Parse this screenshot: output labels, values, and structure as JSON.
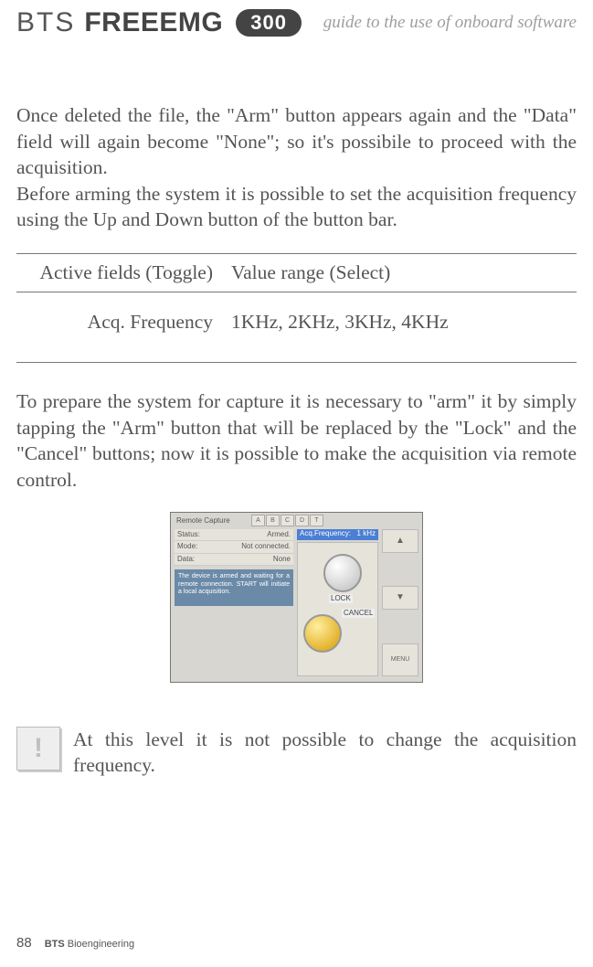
{
  "header": {
    "brand_prefix": "BTS",
    "brand_main": "FREEEMG",
    "badge": "300",
    "subtitle": "guide to the use of onboard software"
  },
  "para1": "Once deleted the file, the \"Arm\" button appears again and the \"Data\" field will again become \"None\"; so it's possibile to proceed with the acquisition.",
  "para2": "Before arming the system it is possible to set the acquisition frequency using the Up and Down button of the button bar.",
  "table": {
    "head_col1": "Active fields (Toggle)",
    "head_col2": "Value range (Select)",
    "row_col1": "Acq. Frequency",
    "row_col2": "1KHz, 2KHz, 3KHz, 4KHz"
  },
  "para3": "To   prepare the system for capture it is necessary to \"arm\" it by  simply tapping the \"Arm\" button that will be replaced by the \"Lock\" and  the \"Cancel\" buttons; now it is possible to make the acquisition via remote control.",
  "screenshot": {
    "title": "Remote Capture",
    "tabs": [
      "A",
      "B",
      "C",
      "D",
      "T"
    ],
    "status_label": "Status:",
    "status_value": "Armed.",
    "mode_label": "Mode:",
    "mode_value": "Not connected.",
    "data_label": "Data:",
    "data_value": "None",
    "highlight_label": "Acq.Frequency:",
    "highlight_value": "1 kHz",
    "msg": "The device is armed and waiting for a remote connection. START will initiate a local acquisition.",
    "lock": "LOCK",
    "cancel": "CANCEL",
    "menu": "MENU"
  },
  "note": "At this level it is not possible to change the acquisition frequency.",
  "footer": {
    "page": "88",
    "brand_bold": "BTS",
    "brand_rest": " Bioengineering"
  }
}
